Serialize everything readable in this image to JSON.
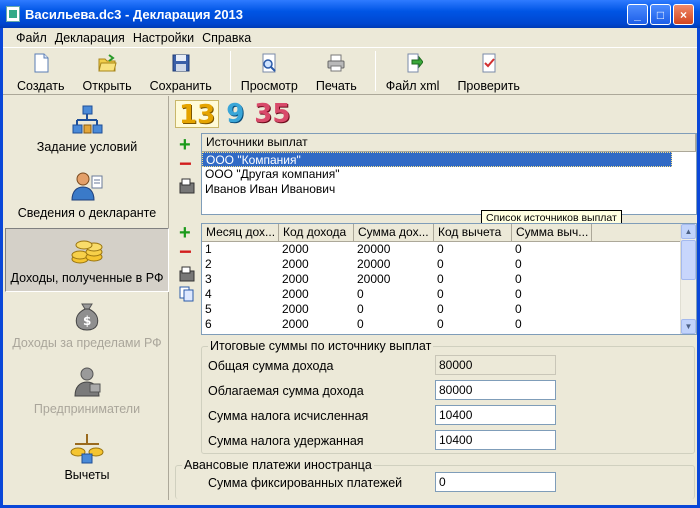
{
  "window": {
    "title": "Васильева.dc3 - Декларация 2013",
    "controls": [
      "_",
      "□",
      "×"
    ]
  },
  "menu": [
    "Файл",
    "Декларация",
    "Настройки",
    "Справка"
  ],
  "toolbar": {
    "create": "Создать",
    "open": "Открыть",
    "save": "Сохранить",
    "preview": "Просмотр",
    "print": "Печать",
    "xml": "Файл xml",
    "check": "Проверить"
  },
  "sidebar": [
    {
      "label": "Задание условий",
      "icon": "conditions-icon",
      "state": "normal"
    },
    {
      "label": "Сведения о декларанте",
      "icon": "declarant-icon",
      "state": "normal"
    },
    {
      "label": "Доходы, полученные в РФ",
      "icon": "coins-icon",
      "state": "active"
    },
    {
      "label": "Доходы за пределами РФ",
      "icon": "money-bag-icon",
      "state": "disabled"
    },
    {
      "label": "Предприниматели",
      "icon": "entrepreneur-icon",
      "state": "disabled"
    },
    {
      "label": "Вычеты",
      "icon": "deductions-icon",
      "state": "normal"
    }
  ],
  "rates": [
    "13",
    "9",
    "35"
  ],
  "sources": {
    "header": "Источники выплат",
    "items": [
      "ООО \"Компания\"",
      "ООО \"Другая компания\"",
      "Иванов Иван Иванович"
    ],
    "selected_index": 0,
    "tooltip": "Список источников выплат"
  },
  "income_table": {
    "columns": [
      "Месяц дох...",
      "Код дохода",
      "Сумма дох...",
      "Код вычета",
      "Сумма выч..."
    ],
    "rows": [
      [
        "1",
        "2000",
        "20000",
        "0",
        "0"
      ],
      [
        "2",
        "2000",
        "20000",
        "0",
        "0"
      ],
      [
        "3",
        "2000",
        "20000",
        "0",
        "0"
      ],
      [
        "4",
        "2000",
        "0",
        "0",
        "0"
      ],
      [
        "5",
        "2000",
        "0",
        "0",
        "0"
      ],
      [
        "6",
        "2000",
        "0",
        "0",
        "0"
      ]
    ]
  },
  "totals": {
    "title": "Итоговые суммы по источнику выплат",
    "total_income_label": "Общая сумма дохода",
    "total_income": "80000",
    "taxable_income_label": "Облагаемая сумма дохода",
    "taxable_income": "80000",
    "tax_calculated_label": "Сумма налога исчисленная",
    "tax_calculated": "10400",
    "tax_withheld_label": "Сумма налога удержанная",
    "tax_withheld": "10400"
  },
  "advance": {
    "title": "Авансовые платежи иностранца",
    "fixed_label": "Сумма фиксированных платежей",
    "fixed_value": "0"
  }
}
